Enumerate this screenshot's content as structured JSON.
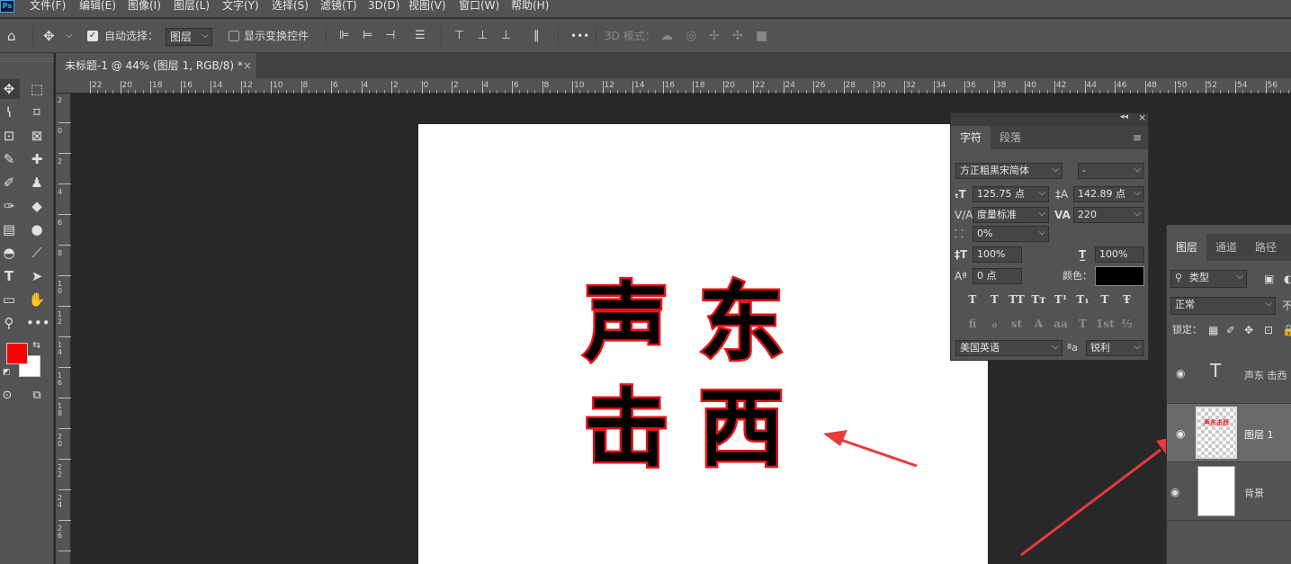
{
  "app": {
    "logo": "Ps"
  },
  "menu": [
    "文件(F)",
    "编辑(E)",
    "图像(I)",
    "图层(L)",
    "文字(Y)",
    "选择(S)",
    "滤镜(T)",
    "3D(D)",
    "视图(V)",
    "窗口(W)",
    "帮助(H)"
  ],
  "options_bar": {
    "auto_select_label": "自动选择：",
    "auto_select_target": "图层",
    "show_transform_label": "显示变换控件",
    "mode_3d_label": "3D 模式：",
    "more": "•••"
  },
  "document_tab": {
    "title": "未标题-1 @ 44% (图层 1, RGB/8) *",
    "close": "×"
  },
  "ruler_h": [
    "22",
    "20",
    "18",
    "16",
    "14",
    "12",
    "10",
    "8",
    "6",
    "4",
    "2",
    "0",
    "2",
    "4",
    "6",
    "8",
    "10",
    "12",
    "14",
    "16",
    "18",
    "20",
    "22",
    "24",
    "26",
    "28",
    "30",
    "32",
    "34",
    "36",
    "38",
    "40",
    "42",
    "44",
    "46",
    "48",
    "50",
    "52",
    "54",
    "56"
  ],
  "ruler_v": [
    "2",
    "0",
    "2",
    "4",
    "6",
    "8",
    "1 0",
    "1 2",
    "1 4",
    "1 6",
    "1 8",
    "2 0",
    "2 2",
    "2 4",
    "2 6"
  ],
  "canvas_text": {
    "line1": [
      "声",
      "东"
    ],
    "line2": [
      "击",
      "西"
    ]
  },
  "colors": {
    "foreground": "#ff0000",
    "background": "#ffffff",
    "stroke": "#e3151a",
    "text_color": "#000000"
  },
  "character_panel": {
    "tabs": [
      "字符",
      "段落"
    ],
    "font_family": "方正粗黑宋简体",
    "font_style": "-",
    "font_size": "125.75 点",
    "leading": "142.89 点",
    "kerning": "度量标准",
    "tracking": "220",
    "tsume": "0%",
    "vertical_scale": "100%",
    "horizontal_scale": "100%",
    "baseline_shift": "0 点",
    "color_label": "颜色：",
    "style_buttons": [
      "T",
      "T",
      "TT",
      "Tт",
      "T¹",
      "T₁",
      "T",
      "Ŧ"
    ],
    "opentype_buttons": [
      "fi",
      "ℴ",
      "st",
      "A",
      "aa",
      "T",
      "1st",
      "½"
    ],
    "language": "美国英语",
    "aa_label": "ªa",
    "antialias": "锐利"
  },
  "layers_panel": {
    "tabs": [
      "图层",
      "通道",
      "路径"
    ],
    "filter": "类型",
    "blend_mode": "正常",
    "opacity_label": "不",
    "lock_label": "锁定：",
    "layers": [
      {
        "name": "声东 击西",
        "type": "text",
        "thumb": "T"
      },
      {
        "name": "图层 1",
        "type": "pixel",
        "thumb": "声东击西"
      },
      {
        "name": "背景",
        "type": "background"
      }
    ]
  }
}
